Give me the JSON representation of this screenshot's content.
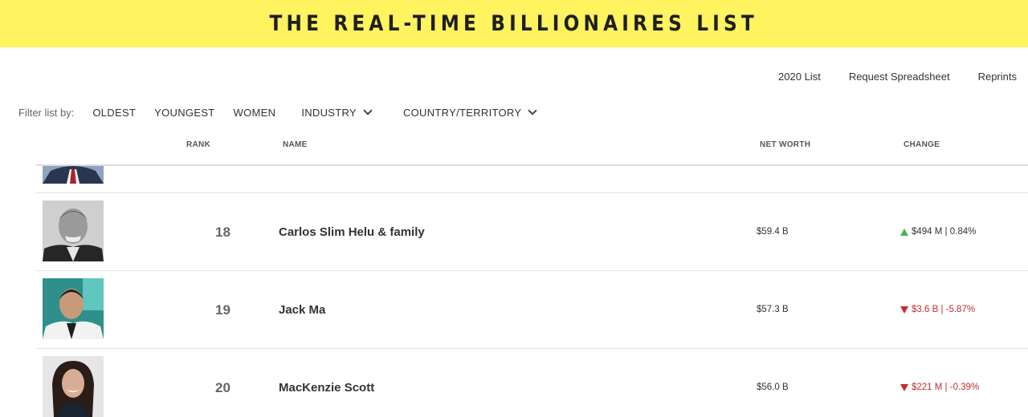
{
  "banner": {
    "title": "THE REAL-TIME BILLIONAIRES LIST"
  },
  "top_links": [
    "2020 List",
    "Request Spreadsheet",
    "Reprints"
  ],
  "filters": {
    "label": "Filter list by:",
    "items": [
      "OLDEST",
      "YOUNGEST",
      "WOMEN"
    ],
    "dropdowns": [
      "INDUSTRY",
      "COUNTRY/TERRITORY"
    ]
  },
  "table": {
    "columns": {
      "rank": "RANK",
      "name": "NAME",
      "net_worth": "NET WORTH",
      "change": "CHANGE"
    },
    "rows": [
      {
        "rank": "18",
        "name": "Carlos Slim Helu & family",
        "net_worth": "$59.4 B",
        "change": "$494 M | 0.84%",
        "direction": "up"
      },
      {
        "rank": "19",
        "name": "Jack Ma",
        "net_worth": "$57.3 B",
        "change": "$3.6 B | -5.87%",
        "direction": "down"
      },
      {
        "rank": "20",
        "name": "MacKenzie Scott",
        "net_worth": "$56.0 B",
        "change": "$221 M | -0.39%",
        "direction": "down"
      }
    ]
  },
  "colors": {
    "banner": "#fff35f",
    "up": "#4caf50",
    "down": "#c62b2b"
  },
  "icons": {
    "dropdown": "chevron-down-icon",
    "increase": "triangle-up-icon",
    "decrease": "triangle-down-icon"
  }
}
